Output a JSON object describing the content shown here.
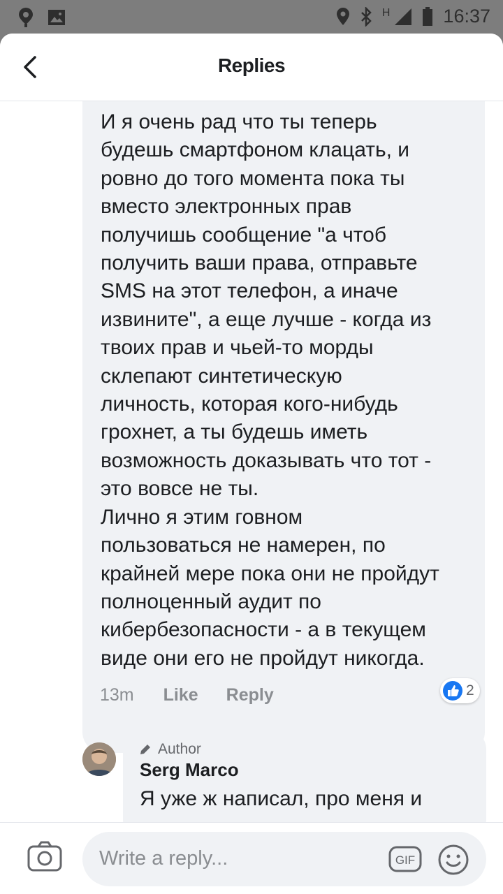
{
  "status_bar": {
    "time": "16:37",
    "network_label": "H"
  },
  "header": {
    "title": "Replies"
  },
  "comment": {
    "text": "И я очень рад что ты теперь\nбудешь смартфоном клацать, и\nровно до того момента пока ты\nвместо электронных прав\nполучишь сообщение \"а чтоб\nполучить ваши права, отправьте\nSMS на этот телефон, а иначе\nизвините\", а еще лучше - когда из\nтвоих прав и чьей-то морды\nсклепают синтетическую\nличность, которая кого-нибудь\nгрохнет, а ты будешь иметь\nвозможность доказывать что тот -\nэто вовсе не ты.\nЛично я этим говном\nпользоваться не намерен, по\nкрайней мере пока они не пройдут\nполноценный аудит по\nкибербезопасности - а в текущем\nвиде они его не пройдут никогда.",
    "time": "13m",
    "like_label": "Like",
    "reply_label": "Reply",
    "reaction_count": "2"
  },
  "reply": {
    "badge": "Author",
    "author": "Serg Marco",
    "text": "Я уже ж написал, про меня и"
  },
  "composer": {
    "placeholder": "Write a reply...",
    "gif_label": "GIF"
  },
  "colors": {
    "like_blue": "#1877f2",
    "bubble_bg": "#f0f2f5",
    "meta_gray": "#8a8d91"
  }
}
